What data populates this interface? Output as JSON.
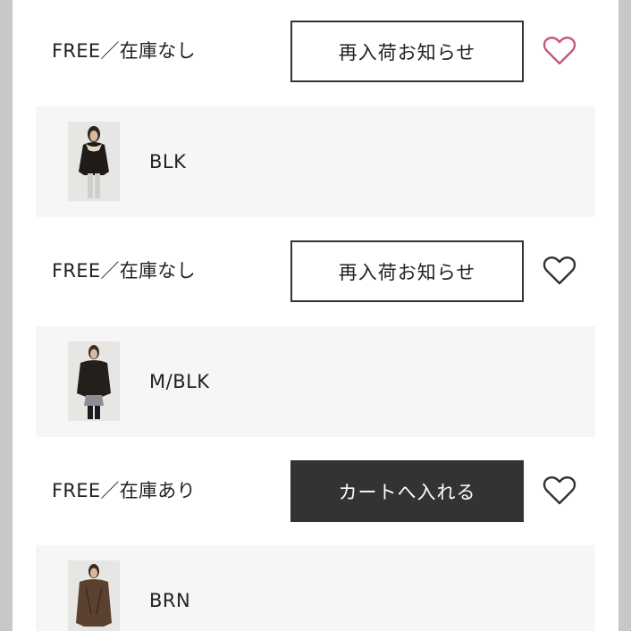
{
  "colors": {
    "accent_heart": "#c8577a",
    "heart_default": "#333333",
    "cart_button_bg": "#333333"
  },
  "variants": [
    {
      "color": "BLK",
      "thumbnail_icon": "model-photo-thumbnail",
      "size_label": "FREE／在庫なし",
      "button_label": "再入荷お知らせ",
      "button_style": "outline",
      "favorite_icon": "heart-outline-icon",
      "favorite_color": "#c8577a"
    },
    {
      "color": "M/BLK",
      "thumbnail_icon": "model-photo-thumbnail",
      "size_label": "FREE／在庫なし",
      "button_label": "再入荷お知らせ",
      "button_style": "outline",
      "favorite_icon": "heart-outline-icon",
      "favorite_color": "#333333"
    },
    {
      "color": "BRN",
      "thumbnail_icon": "model-photo-thumbnail",
      "size_label": "FREE／在庫あり",
      "button_label": "カートへ入れる",
      "button_style": "filled",
      "favorite_icon": "heart-outline-icon",
      "favorite_color": "#333333"
    }
  ]
}
